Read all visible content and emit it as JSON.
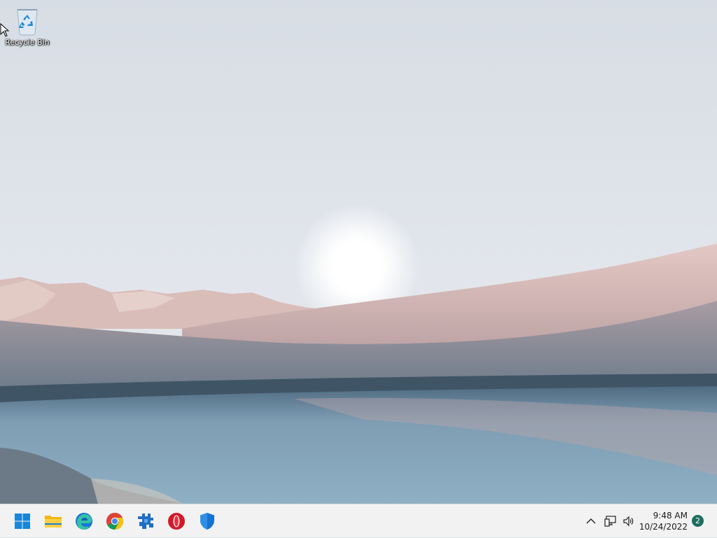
{
  "desktop": {
    "icons": [
      {
        "label": "Recycle Bin",
        "icon": "recycle-bin-icon"
      }
    ]
  },
  "taskbar": {
    "apps": [
      {
        "name": "start",
        "icon": "windows-start-icon"
      },
      {
        "name": "file-explorer",
        "icon": "folder-icon"
      },
      {
        "name": "edge",
        "icon": "edge-icon"
      },
      {
        "name": "chrome",
        "icon": "chrome-icon"
      },
      {
        "name": "app",
        "icon": "puzzle-app-icon"
      },
      {
        "name": "opera",
        "icon": "opera-icon"
      },
      {
        "name": "defender",
        "icon": "shield-icon"
      }
    ],
    "tray": {
      "time": "9:48 AM",
      "date": "10/24/2022",
      "notification_count": "2"
    }
  },
  "colors": {
    "accent": "#0078d4",
    "taskbar_bg": "#f2f2f2",
    "badge": "#1e6e60"
  }
}
